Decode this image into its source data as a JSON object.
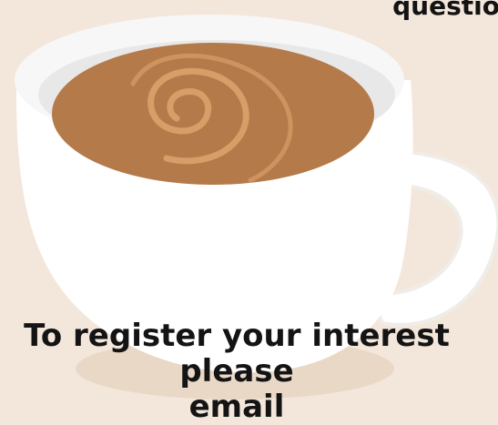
{
  "header": {
    "top_text": "questio"
  },
  "cta": {
    "line1": "To register your interest please",
    "line2": "email"
  },
  "graphic": {
    "type": "coffee-cup-icon",
    "background_color": "#f3e7dc",
    "cup_color": "#ffffff",
    "coffee_color": "#b47a49",
    "swirl_color": "#d79e68"
  }
}
